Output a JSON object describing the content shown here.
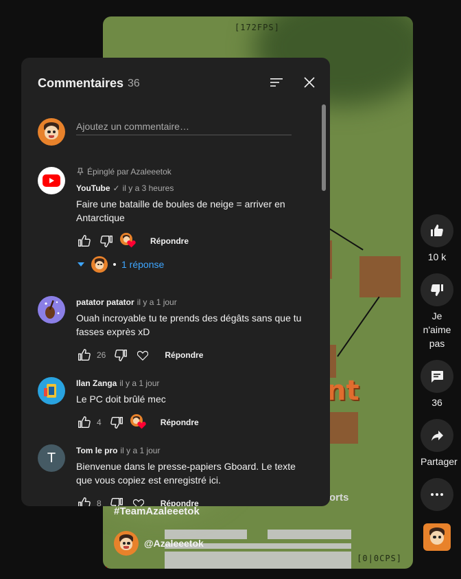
{
  "video": {
    "fps_top": "[172FPS]",
    "fps_bottom": "[0|0CPS]",
    "overlay_text": "nt",
    "caption_partial": "orts",
    "hashtag": "#TeamAzaleeetok",
    "channel_handle": "@Azaleeetok"
  },
  "rail": {
    "like_count": "10 k",
    "dislike_label": "Je n'aime pas",
    "comments_count": "36",
    "share_label": "Partager"
  },
  "panel": {
    "title": "Commentaires",
    "count": "36",
    "add_placeholder": "Ajoutez un commentaire…"
  },
  "comments": [
    {
      "pinned": "Épinglé par Azaleeetok",
      "author": "YouTube",
      "verified": "✓",
      "time": "il y a 3 heures",
      "text": "Faire une bataille de boules de neige = arriver en Antarctique",
      "like_count": "",
      "reply_label": "Répondre",
      "replies_label": "1 réponse"
    },
    {
      "author": "patator patator",
      "time": "il y a 1 jour",
      "text": "Ouah incroyable tu te prends des dégâts sans que tu fasses exprès xD",
      "like_count": "26",
      "reply_label": "Répondre"
    },
    {
      "author": "Ilan Zanga",
      "time": "il y a 1 jour",
      "text": "Le PC doit brûlé mec",
      "like_count": "4",
      "reply_label": "Répondre"
    },
    {
      "author": "Tom le pro",
      "avatar_letter": "T",
      "time": "il y a 1 jour",
      "text": "Bienvenue dans le presse-papiers Gboard. Le texte que vous copiez est enregistré ici.",
      "like_count": "8",
      "reply_label": "Répondre"
    }
  ],
  "colors": {
    "panel_bg": "#212121",
    "page_bg": "#0f0f0f",
    "link_blue": "#3ea6ff",
    "heart_red": "#ff0033",
    "avatar_orange": "#e8822b"
  }
}
